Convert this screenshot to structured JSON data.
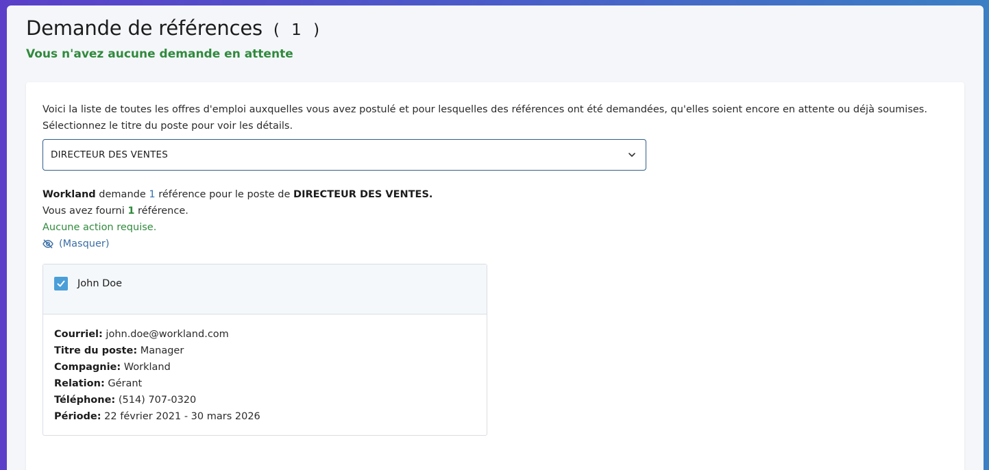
{
  "header": {
    "title": "Demande de références",
    "count": "( 1 )",
    "subtitle": "Vous n'avez aucune demande en attente"
  },
  "intro": {
    "line1": "Voici la liste de toutes les offres d'emploi auxquelles vous avez postulé et pour lesquelles des références ont été demandées, qu'elles soient encore en attente ou déjà soumises.",
    "line2": "Sélectionnez le titre du poste pour voir les détails."
  },
  "job_select": {
    "value": "DIRECTEUR DES VENTES",
    "icon": "chevron-down-icon"
  },
  "request_info": {
    "company": "Workland",
    "text_demande": " demande ",
    "requested_count": "1",
    "text_reference": " référence  pour le poste de ",
    "job_title": "DIRECTEUR DES VENTES.",
    "provided_prefix": "Vous avez fourni ",
    "provided_count": "1",
    "provided_suffix": " référence.",
    "status": "Aucune action requise.",
    "hide_label": "(Masquer)",
    "hide_icon": "eye-off-icon"
  },
  "reference": {
    "name": "John Doe",
    "checked": true,
    "fields": [
      {
        "label": "Courriel:",
        "value": " john.doe@workland.com"
      },
      {
        "label": "Titre du poste:",
        "value": " Manager"
      },
      {
        "label": "Compagnie:",
        "value": " Workland"
      },
      {
        "label": "Relation:",
        "value": " Gérant"
      },
      {
        "label": "Téléphone:",
        "value": " (514) 707-0320"
      },
      {
        "label": "Période:",
        "value": " 22 février 2021 - 30 mars 2026"
      }
    ]
  },
  "colors": {
    "accent_green": "#2f8a3c",
    "accent_blue": "#2f6fad",
    "checkbox_blue": "#4a9fd8"
  }
}
